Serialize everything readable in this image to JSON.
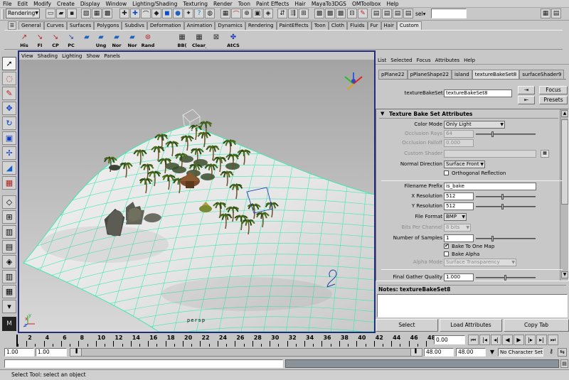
{
  "menubar": [
    "File",
    "Edit",
    "Modify",
    "Create",
    "Display",
    "Window",
    "Lighting/Shading",
    "Texturing",
    "Render",
    "Toon",
    "Paint Effects",
    "Hair",
    "MayaTo3DGS",
    "OMToolbox",
    "Help"
  ],
  "statusline": {
    "mode": "Rendering",
    "sel_label": "sel▾",
    "sel_value": ""
  },
  "shelf": {
    "tabs": [
      "General",
      "Curves",
      "Surfaces",
      "Polygons",
      "Subdivs",
      "Deformation",
      "Animation",
      "Dynamics",
      "Rendering",
      "PaintEffects",
      "Toon",
      "Cloth",
      "Fluids",
      "Fur",
      "Hair",
      "Custom"
    ],
    "active_tab": "Custom",
    "buttons": [
      "His",
      "FI",
      "CP",
      "PC",
      "",
      "Ung",
      "Nor",
      "Nor",
      "Rand",
      "BB(",
      "Clear_Ext_M",
      "",
      "AtCS"
    ]
  },
  "viewport": {
    "menu": [
      "View",
      "Shading",
      "Lighting",
      "Show",
      "Panels"
    ],
    "camera": "persp",
    "axis_labels": {
      "x": "x",
      "y": "y",
      "z": "z"
    },
    "grid_color": "#3de8b0",
    "bg_top": "#a4a4a4",
    "bg_bottom": "#d8d8d8"
  },
  "attr_editor": {
    "menu": [
      "List",
      "Selected",
      "Focus",
      "Attributes",
      "Help"
    ],
    "tabs": [
      "pPlane22",
      "pPlaneShape22",
      "island",
      "textureBakeSet8",
      "surfaceShader9"
    ],
    "active_tab": "textureBakeSet8",
    "node_label": "textureBakeSet:",
    "node_value": "textureBakeSet8",
    "focus_label": "Focus",
    "presets_label": "Presets",
    "section": "Texture Bake Set Attributes",
    "color_mode": {
      "label": "Color Mode",
      "value": "Only Light"
    },
    "occlusion_rays": {
      "label": "Occlusion Rays",
      "value": "64",
      "slider": 0.27
    },
    "occlusion_falloff": {
      "label": "Occlusion Falloff",
      "value": "0.000"
    },
    "custom_shader": {
      "label": "Custom Shader",
      "value": ""
    },
    "normal_direction": {
      "label": "Normal Direction",
      "value": "Surface Front"
    },
    "orthogonal_reflection": {
      "label": "Orthogonal Reflection",
      "checked": false
    },
    "filename_prefix": {
      "label": "Filename Prefix",
      "value": "is_bake"
    },
    "x_resolution": {
      "label": "X Resolution",
      "value": "512",
      "slider": 0.45
    },
    "y_resolution": {
      "label": "Y Resolution",
      "value": "512",
      "slider": 0.45
    },
    "file_format": {
      "label": "File Format",
      "value": "BMP"
    },
    "bits_per_channel": {
      "label": "Bits Per Channel",
      "value": "8 bits"
    },
    "number_of_samples": {
      "label": "Number of Samples",
      "value": "1",
      "slider": 0.27
    },
    "bake_to_one_map": {
      "label": "Bake To One Map",
      "checked": true
    },
    "bake_alpha": {
      "label": "Bake Alpha",
      "checked": false
    },
    "alpha_mode": {
      "label": "Alpha Mode",
      "value": "Surface Transparency"
    },
    "final_gather_quality": {
      "label": "Final Gather Quality",
      "value": "1.000",
      "slider": 0.5
    },
    "notes_label": "Notes: textureBakeSet8",
    "select_label": "Select",
    "load_label": "Load Attributes",
    "copy_label": "Copy Tab"
  },
  "timeline": {
    "ticks": [
      "2",
      "4",
      "6",
      "8",
      "10",
      "12",
      "14",
      "16",
      "18",
      "20",
      "22",
      "24",
      "26",
      "28",
      "30",
      "32",
      "34",
      "36",
      "38",
      "40",
      "42",
      "44",
      "46",
      "48"
    ],
    "current_time": "0.00"
  },
  "range": {
    "start": "1.00",
    "inner_start": "1.00",
    "inner_end": "48.00",
    "end": "48.00",
    "character_set": "No Character Set"
  },
  "helpline": "Select Tool: select an object"
}
